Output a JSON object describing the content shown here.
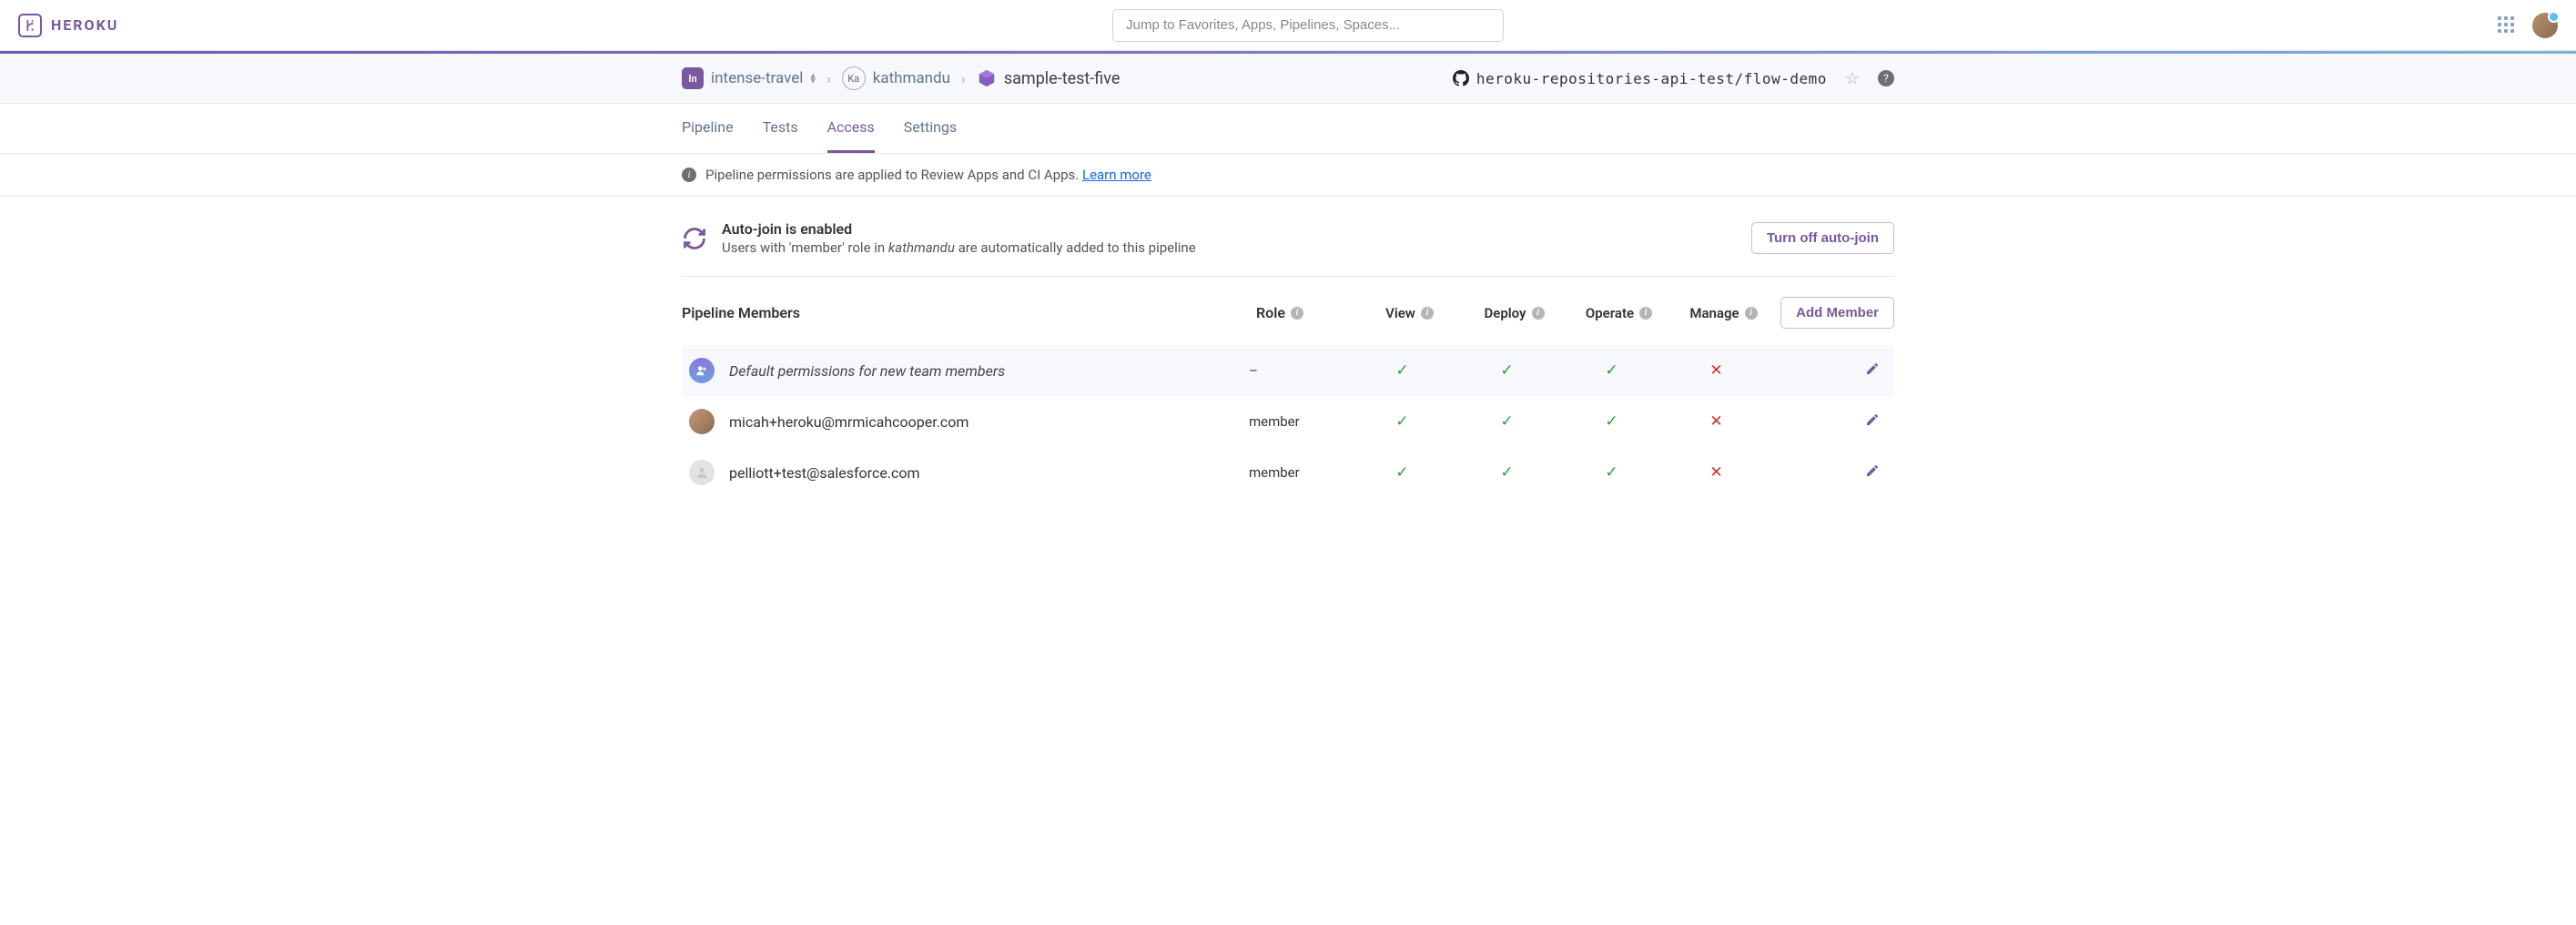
{
  "header": {
    "brand": "HEROKU",
    "search_placeholder": "Jump to Favorites, Apps, Pipelines, Spaces..."
  },
  "breadcrumb": {
    "team_badge": "In",
    "team": "intense-travel",
    "org_badge": "Ka",
    "org": "kathmandu",
    "app": "sample-test-five",
    "repo": "heroku-repositories-api-test/flow-demo"
  },
  "tabs": [
    "Pipeline",
    "Tests",
    "Access",
    "Settings"
  ],
  "active_tab": "Access",
  "info": {
    "text": "Pipeline permissions are applied to Review Apps and CI Apps. ",
    "link": "Learn more"
  },
  "autojoin": {
    "title": "Auto-join is enabled",
    "desc_pre": "Users with 'member' role in ",
    "desc_em": "kathmandu",
    "desc_post": " are automatically added to this pipeline",
    "button": "Turn off auto-join"
  },
  "table": {
    "title": "Pipeline Members",
    "columns": {
      "role": "Role",
      "view": "View",
      "deploy": "Deploy",
      "operate": "Operate",
      "manage": "Manage"
    },
    "add_button": "Add Member",
    "rows": [
      {
        "type": "default",
        "name": "Default permissions for new team members",
        "role": "–",
        "view": true,
        "deploy": true,
        "operate": true,
        "manage": false
      },
      {
        "type": "person",
        "name": "micah+heroku@mrmicahcooper.com",
        "role": "member",
        "view": true,
        "deploy": true,
        "operate": true,
        "manage": false
      },
      {
        "type": "blank",
        "name": "pelliott+test@salesforce.com",
        "role": "member",
        "view": true,
        "deploy": true,
        "operate": true,
        "manage": false
      }
    ]
  }
}
